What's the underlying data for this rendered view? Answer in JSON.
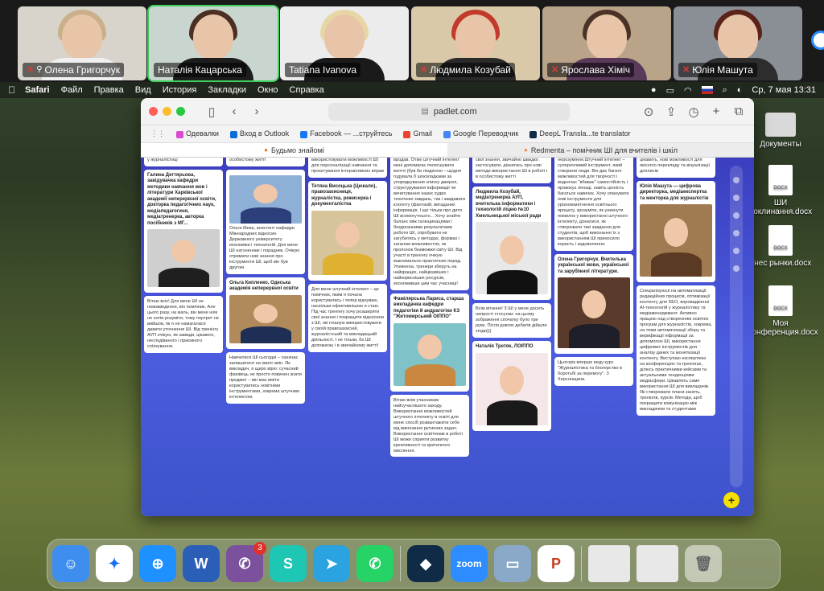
{
  "zoom": {
    "participants": [
      {
        "name": "Олена Григорчук",
        "pinned": true,
        "muted": true,
        "active": false
      },
      {
        "name": "Наталія Кацарська",
        "pinned": false,
        "muted": false,
        "active": true
      },
      {
        "name": "Tatiana Ivanova",
        "pinned": false,
        "muted": false,
        "active": false
      },
      {
        "name": "Людмила Козубай",
        "pinned": false,
        "muted": true,
        "active": false
      },
      {
        "name": "Ярослава Хіміч",
        "pinned": false,
        "muted": true,
        "active": false
      },
      {
        "name": "Юлія Машута",
        "pinned": false,
        "muted": true,
        "active": false
      }
    ]
  },
  "menubar": {
    "app": "Safari",
    "menus": [
      "Файл",
      "Правка",
      "Вид",
      "История",
      "Закладки",
      "Окно",
      "Справка"
    ],
    "datetime": "Ср, 7 мая  13:31"
  },
  "desktop": {
    "items": [
      {
        "label": "Документы",
        "icon": "folder-icon"
      },
      {
        "label": "ШИ поклинання.docx",
        "icon": "document-icon"
      },
      {
        "label": "анес рынки.docx",
        "icon": "document-icon"
      },
      {
        "label": "Моя конференция.docx",
        "icon": "document-icon"
      }
    ]
  },
  "safari": {
    "url": "padlet.com",
    "favorites": [
      {
        "label": "Одевалки",
        "color": "#d94bd1"
      },
      {
        "label": "Вход в Outlook",
        "color": "#0a6cd6"
      },
      {
        "label": "Facebook — ...струйтесь",
        "color": "#1877f2"
      },
      {
        "label": "Gmail",
        "color": "#ea4335"
      },
      {
        "label": "Google Переводчик",
        "color": "#4285f4"
      },
      {
        "label": "DeepL Transla...te translator",
        "color": "#0f2b46"
      }
    ],
    "tabs": [
      {
        "label": "Будьмо знайомі",
        "active": true
      },
      {
        "label": "Redmenta – помічник ШІ для вчителів і шкіл",
        "active": false
      }
    ]
  },
  "padlet": {
    "columns": [
      [
        {
          "title": "",
          "text": "у журналістиці",
          "image": false
        },
        {
          "title": "Галина Дегтярьова, завідувачка кафедри методики навчання мов і літератури Харківської академії неперервної освіти, докторка педагогічних наук, медіапедагогиня, медіатренерка, авторка посібників з МГ...",
          "text": "",
          "image": true,
          "img_color": "#cfcfcf",
          "suit": "#1f1f1f"
        },
        {
          "title": "",
          "text": "Вітаю всіх! Для мене ШІ не нововведення, він помічник. Але цього разу, на жаль, він мене ніяк не хотів розуміти, тому портрет не вийшов, як я не намагалася давати уточнення ШІ. Від тренінгу АУП очікую, як завжди, цікавого, несподіваного і приємного спілкування.",
          "image": false
        }
      ],
      [
        {
          "title": "",
          "text": "особистому житті",
          "image": false
        },
        {
          "title": "",
          "text": "Ольга Миза, асистент кафедри Міжнародних відносин Державного університету економіки і технологій. Для мене ШІ натхненник і порадник. Очікую отримати нові знання про інструменти ШІ, щоб він був другом.",
          "image": true,
          "img_color": "#8fb0d6",
          "suit": "#2d3f7a"
        },
        {
          "title": "Ольга Кипленко, Одеська академія неперервної освіти",
          "text": "",
          "image": true,
          "img_color": "#b08a5a",
          "suit": "#1f2e55"
        },
        {
          "title": "",
          "text": "Навчатися ШІ сьогодні – означає залишатися на хвилі змін. Як викладач, я щиро вірю: сучасний фахівець не просто повинен знати предмет – він має вміти користуватись новітніми інструментами, зокрема штучним інтелектом.",
          "image": false
        }
      ],
      [
        {
          "title": "",
          "text": "використовувати можливості ШІ для персоналізації навчання та проєктування інтерактивних вправ",
          "image": false
        },
        {
          "title": "Тетяна Висоцька (Цюкало), правозахисниця, журналістка, режисерка і документалістка",
          "text": "",
          "image": true,
          "img_color": "#d7c49a",
          "suit": "#e0b030"
        },
        {
          "title": "",
          "text": "Для мене штучний інтелект – це помічник, яким я почала користуватись і тепер відчуваю, наскільки ефективнішою я стаю. Під час тренінгу хочу розширити свої знання і покращити відносини з ШІ, які планую використовувати у своїй правозахисній, журналістській та викладацькій діяльності. І не тільки, бо ШІ допомагає і в звичайному житті!",
          "image": false
        }
      ],
      [
        {
          "title": "",
          "text": "вродав. Отже штучний інтелект мені допомагає полегшувати життя (був би людиною – щодня годувала б шоколадками за упорядкування списку джерел, структурування інформації чи вичитування інших худих технічних завдань, так і завдавати клопоту (фантазій, вигаданих інформація. І ще тільки про дитя ШІ всемогутнього... Хочу знайти баланс між галюцинаціями і бездоганними результатами роботи ШІ, спробувати не загубитись у методах, формах і загалом можливостях, як пролонок безмежжя світу ШІ. Від участі в тренінгу очікую максимально практичних порад. Упевнена, тренери зберуть на найкращих, найцікавіших і найкорисніших ресурсів, економивши цим час учасниці!",
          "image": false
        },
        {
          "title": "Фамілярська Лариса, старша викладачка кафедри педагогіки й андрагогіки КЗ \"Житомирський ОІППО\"",
          "text": "",
          "image": true,
          "img_color": "#7fc2c8",
          "suit": "#c9873f"
        },
        {
          "title": "",
          "text": "Вітаю всім учасникам найсучаснішого заходу. Використання можливостей штучного інтелекту в освіті для мене спосіб розвантажити себе від виконання рутинних задач. Використання освітянам в роботі ШІ може сприяти розвитку креативності та критичного мислення.",
          "image": false
        }
      ],
      [
        {
          "title": "",
          "text": "свої знання, звичайно швидко застосувати, дізнатись про нові методи використання ШІ в роботі і в особистому житті",
          "image": false
        },
        {
          "title": "Людмила Козубай, медіатренерка АУП, вчителька інформатики і технологій ліцею №10 Хмельницької міської ради",
          "text": "",
          "image": true,
          "img_color": "#e8e8e8",
          "suit": "#111111"
        },
        {
          "title": "",
          "text": "Всім вітання! З ШІ у мене досить непрості стосунки: на цьому зображенні спочатку було три руки. Після довгих дебатів дійшли згоди)))",
          "image": false
        },
        {
          "title": "Наталія Третяк, ЛОІППО",
          "text": "",
          "image": true,
          "img_color": "#f5e6e8",
          "suit": "#1a1a1a"
        }
      ],
      [
        {
          "title": "",
          "text": "нерозуміння.Штучний інтелект – суперечливий інструмент, який створили люди. Він дає багато можливостей для творчості і водночас \"вбиває\" самостійність і провокує лінощі, навіть цінність багатьох навичок. Хочу опанувати нові інструменти для урізноманітнення освітнього процесу, зрозуміти, як уникнути помилок у використанні штучного інтелекту, дізнатися, як створювати такі завдання для студентів, щоб виконання їх з використанням ШІ приносило користь і задоволення.",
          "image": false
        },
        {
          "title": "Олена Григорчук. Вчителька української мови, української та зарубіжної літератури.",
          "text": "",
          "image": true,
          "img_color": "#5a3a2a",
          "suit": "#1f1f2a"
        },
        {
          "title": "",
          "text": "Цьогорiк вперше веду курс \"Журналістика та блогерство в боротьбі за перемогу\". З Херсонщини.",
          "image": false
        }
      ],
      [
        {
          "title": "",
          "text": "цікавить, нові можливості для якісного перекладу та візуалізації доплисів",
          "image": false
        },
        {
          "title": "Юлія Машута — цифрова директорка, медіаекспертка та менторка для журналістів",
          "text": "",
          "image": true,
          "img_color": "#a07a50",
          "suit": "#5a3a22"
        },
        {
          "title": "",
          "text": "Спеціалізуюся на автоматизації редакційних процесів, оптимізації контенту для SEO, впровадженні AI-технологій у журналістику та медіаменеджмент. Активно працюю над створенням освітніх програм для журналістів, зокрема, на теми автоматизації збору та верифікації інформації за допомогою ШІ, використання цифрових інструментів для аналізу даних та монетизації контенту. Виступаю експерткою на конференціях та тренінгах, ділюсь практичними кейсами та актуальними тенденціями медіасфери. Цікавлять саме використання ШІ для викладачів. Як створювати плани занять, тренінгів, курсів. Методи, щоб покращити комунікацію між викладачем та студентами",
          "image": false
        }
      ]
    ]
  },
  "dock": {
    "apps": [
      {
        "name": "finder-icon",
        "color": "#3e8ef0",
        "glyph": "☺"
      },
      {
        "name": "messenger-icon",
        "color": "#ffffff",
        "glyph": "✦"
      },
      {
        "name": "safari-icon",
        "color": "#1e90ff",
        "glyph": "⊕"
      },
      {
        "name": "word-icon",
        "color": "#2b5fb7",
        "glyph": "W"
      },
      {
        "name": "viber-icon",
        "color": "#7b519d",
        "glyph": "✆",
        "badge": "3"
      },
      {
        "name": "surfshark-icon",
        "color": "#1ec6b4",
        "glyph": "S"
      },
      {
        "name": "telegram-icon",
        "color": "#2aa3e0",
        "glyph": "➤"
      },
      {
        "name": "whatsapp-icon",
        "color": "#25d366",
        "glyph": "✆"
      },
      {
        "name": "deepl-icon",
        "color": "#0f2b46",
        "glyph": "◆"
      },
      {
        "name": "zoom-icon",
        "color": "#2d8cff",
        "glyph": "zoom"
      },
      {
        "name": "preview-icon",
        "color": "#8aa9c9",
        "glyph": "▭"
      },
      {
        "name": "powerpoint-icon",
        "color": "#ffffff",
        "glyph": "P"
      }
    ]
  }
}
